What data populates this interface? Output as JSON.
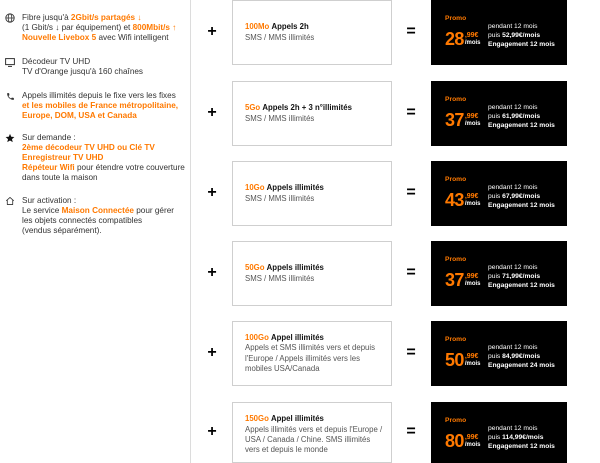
{
  "colors": {
    "accent": "#ff7900",
    "price_box": "#000000",
    "text": "#333333"
  },
  "symbols": {
    "plus": "+",
    "equals": "="
  },
  "features": [
    {
      "icon": "globe-icon",
      "lines": [
        [
          "Fibre jusqu'à ",
          "2Gbit/s partagés ↓"
        ],
        [
          "(1 Gbit/s ↓ par équipement) et ",
          "800Mbit/s ↑"
        ],
        [
          "Nouvelle Livebox 5",
          " avec Wifi intelligent"
        ]
      ]
    },
    {
      "icon": "tv-icon",
      "lines": [
        [
          "Décodeur TV UHD"
        ],
        [
          "TV d'Orange jusqu'à 160 chaînes"
        ]
      ]
    },
    {
      "icon": "phone-icon",
      "lines": [
        [
          "Appels illimités depuis le fixe vers les fixes"
        ],
        [
          "et les mobiles de France métropolitaine,"
        ],
        [
          "Europe, DOM, USA et Canada"
        ]
      ]
    },
    {
      "icon": "star-icon",
      "lines": [
        [
          "Sur demande :"
        ],
        [
          "2ème décodeur TV UHD ou Clé TV"
        ],
        [
          "Enregistreur TV UHD"
        ],
        [
          "Répéteur Wifi",
          " pour étendre votre couverture"
        ],
        [
          "dans toute la maison"
        ]
      ]
    },
    {
      "icon": "home-icon",
      "lines": [
        [
          "Sur activation :"
        ],
        [
          "Le service ",
          "Maison Connectée",
          " pour gérer"
        ],
        [
          "les objets connectés compatibles"
        ],
        [
          "(vendus séparément)."
        ]
      ]
    }
  ],
  "offers": [
    {
      "data": "100Mo",
      "calls": "Appels 2h",
      "details": [
        "SMS / MMS illimités"
      ],
      "badge": "Promo",
      "price": {
        "int": "28",
        "dec": ",99€",
        "unit": "/mois"
      },
      "duration": "pendant 12 mois",
      "after_prefix": "puis ",
      "after_price": "52,99€/mois",
      "commitment": "Engagement 12 mois"
    },
    {
      "data": "5Go",
      "calls": "Appels 2h + 3 n°illimités",
      "details": [
        "SMS / MMS illimités"
      ],
      "badge": "Promo",
      "price": {
        "int": "37",
        "dec": ",99€",
        "unit": "/mois"
      },
      "duration": "pendant 12 mois",
      "after_prefix": "puis ",
      "after_price": "61,99€/mois",
      "commitment": "Engagement 12 mois"
    },
    {
      "data": "10Go",
      "calls": "Appels illimités",
      "details": [
        "SMS / MMS illimités"
      ],
      "badge": "Promo",
      "price": {
        "int": "43",
        "dec": ",99€",
        "unit": "/mois"
      },
      "duration": "pendant 12 mois",
      "after_prefix": "puis ",
      "after_price": "67,99€/mois",
      "commitment": "Engagement 12 mois"
    },
    {
      "data": "50Go",
      "calls": "Appels illimités",
      "details": [
        "SMS / MMS illimités"
      ],
      "badge": "Promo",
      "price": {
        "int": "37",
        "dec": ",99€",
        "unit": "/mois"
      },
      "duration": "pendant 12 mois",
      "after_prefix": "puis ",
      "after_price": "71,99€/mois",
      "commitment": "Engagement 12 mois"
    },
    {
      "data": "100Go",
      "calls": "Appel illimités",
      "details": [
        "Appels et SMS illimités vers et depuis",
        "l'Europe / Appels illimités vers les",
        "mobiles USA/Canada"
      ],
      "badge": "Promo",
      "price": {
        "int": "50",
        "dec": ",99€",
        "unit": "/mois"
      },
      "duration": "pendant 12 mois",
      "after_prefix": "puis ",
      "after_price": "84,99€/mois",
      "commitment": "Engagement 24 mois"
    },
    {
      "data": "150Go",
      "calls": "Appel illimités",
      "details": [
        "Appels illimités vers et depuis l'Europe /",
        "USA / Canada / Chine. SMS illimités",
        "vers et depuis le monde"
      ],
      "badge": "Promo",
      "price": {
        "int": "80",
        "dec": ",99€",
        "unit": "/mois"
      },
      "duration": "pendant 12 mois",
      "after_prefix": "puis ",
      "after_price": "114,99€/mois",
      "commitment": "Engagement 12 mois"
    }
  ]
}
